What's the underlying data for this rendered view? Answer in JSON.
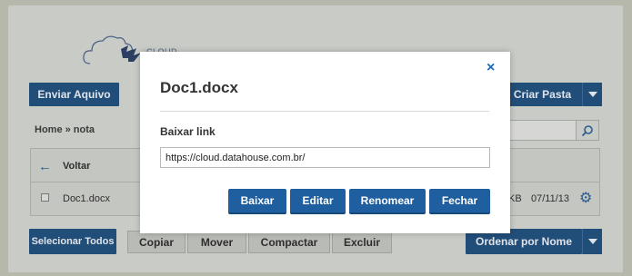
{
  "brand": {
    "logo_text": "CLOUD"
  },
  "toolbar": {
    "upload_label": "Enviar Aquivo",
    "create_folder_label": "Criar Pasta"
  },
  "breadcrumb": {
    "text": "Home » nota"
  },
  "file_list": {
    "back_label": "Voltar",
    "rows": [
      {
        "name": "Doc1.docx",
        "size": "KB",
        "date": "07/11/13"
      }
    ]
  },
  "bottom_bar": {
    "select_all": "Selecionar Todos",
    "copy": "Copiar",
    "move": "Mover",
    "compress": "Compactar",
    "delete": "Excluir",
    "sort": "Ordenar por Nome"
  },
  "modal": {
    "title": "Doc1.docx",
    "close": "×",
    "link_label": "Baixar link",
    "link_value": "https://cloud.datahouse.com.br/",
    "buttons": {
      "download": "Baixar",
      "edit": "Editar",
      "rename": "Renomear",
      "close": "Fechar"
    }
  },
  "colors": {
    "primary": "#1f5fa0",
    "dimmed_primary": "#214d79",
    "overlay": "#b5b8aa"
  }
}
